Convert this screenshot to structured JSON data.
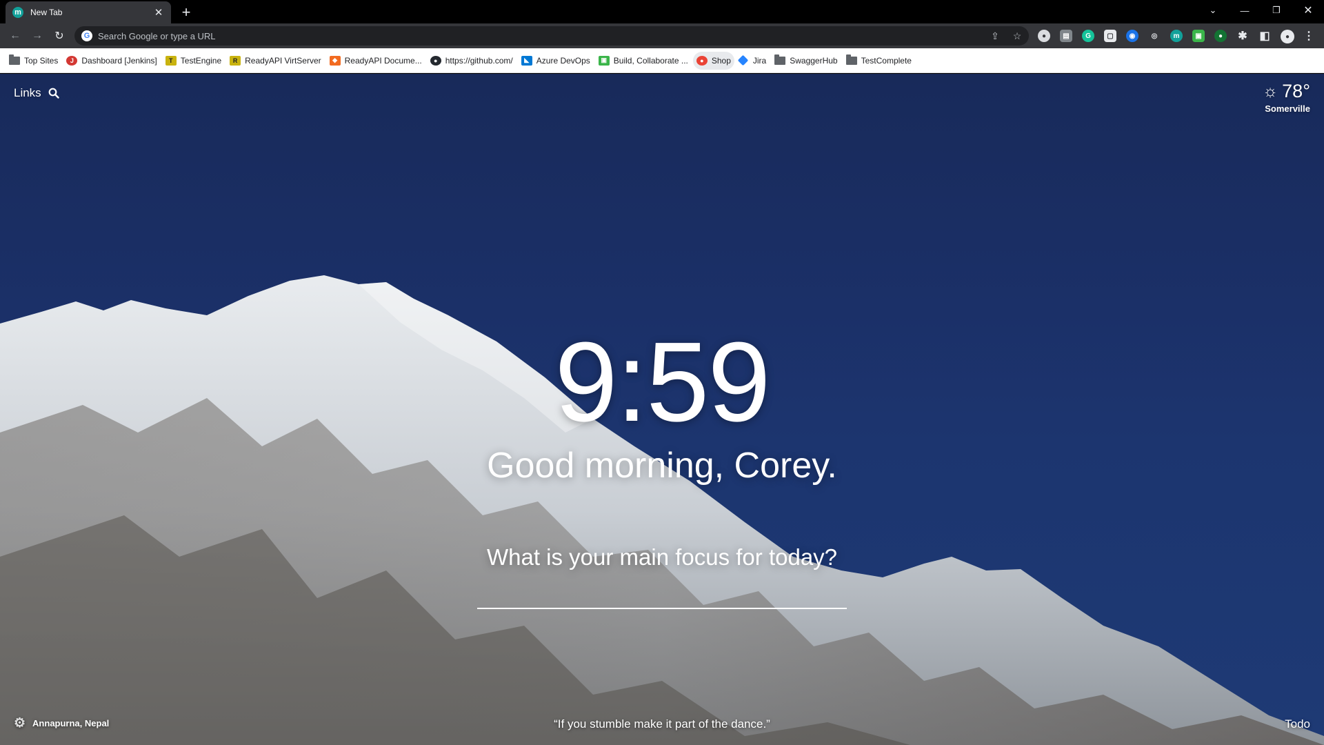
{
  "tab": {
    "title": "New Tab",
    "favicon": "m"
  },
  "omnibox": {
    "placeholder": "Search Google or type a URL"
  },
  "bookmarks": [
    {
      "label": "Top Sites",
      "icon": "folder"
    },
    {
      "label": "Dashboard [Jenkins]",
      "icon": "jenkins-icon"
    },
    {
      "label": "TestEngine",
      "icon": "testengine-icon"
    },
    {
      "label": "ReadyAPI VirtServer",
      "icon": "readyapi-icon"
    },
    {
      "label": "ReadyAPI Docume...",
      "icon": "readyapi-docs-icon"
    },
    {
      "label": "https://github.com/",
      "icon": "github-icon"
    },
    {
      "label": "Azure DevOps",
      "icon": "azure-devops-icon"
    },
    {
      "label": "Build, Collaborate ...",
      "icon": "build-icon"
    },
    {
      "label": "Shop",
      "icon": "shop-icon"
    },
    {
      "label": "Jira",
      "icon": "jira-icon"
    },
    {
      "label": "SwaggerHub",
      "icon": "folder"
    },
    {
      "label": "TestComplete",
      "icon": "folder"
    }
  ],
  "momentum": {
    "links_label": "Links",
    "weather": {
      "temperature": "78°",
      "location": "Somerville",
      "icon": "sun-icon"
    },
    "time": "9:59",
    "greeting": "Good morning, Corey.",
    "focus_prompt": "What is your main focus for today?",
    "photo_location": "Annapurna, Nepal",
    "quote": "“If you stumble make it part of the dance.”",
    "todo_label": "Todo"
  },
  "colors": {
    "sky": "#1b3068",
    "toolbar": "#35363a",
    "omnibox": "#202124",
    "bookmarks_bar": "#ffffff"
  }
}
